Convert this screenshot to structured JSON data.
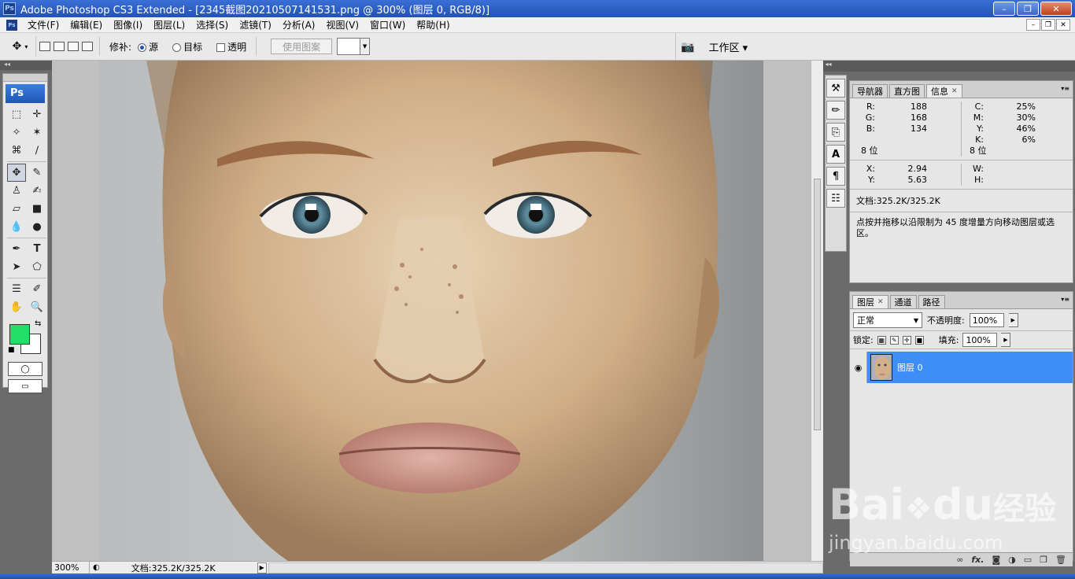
{
  "window": {
    "app_icon": "Ps",
    "title": "Adobe Photoshop CS3 Extended - [2345截图20210507141531.png @ 300% (图层 0, RGB/8)]",
    "controls": [
      "minimize",
      "maximize",
      "close"
    ]
  },
  "menubar": {
    "items": [
      "文件(F)",
      "编辑(E)",
      "图像(I)",
      "图层(L)",
      "选择(S)",
      "滤镜(T)",
      "分析(A)",
      "视图(V)",
      "窗口(W)",
      "帮助(H)"
    ]
  },
  "options": {
    "repair_label": "修补:",
    "source_label": "源",
    "target_label": "目标",
    "transparent_label": "透明",
    "use_pattern_label": "使用图案",
    "workspace_label": "工作区"
  },
  "toolbox": {
    "logo": "Ps",
    "foreground_color": "#22dd66",
    "background_color": "#ffffff",
    "tools": [
      "marquee-icon",
      "move-icon",
      "lasso-icon",
      "magic-wand-icon",
      "crop-icon",
      "slice-icon",
      "patch-icon",
      "brush-icon",
      "stamp-icon",
      "history-brush-icon",
      "eraser-icon",
      "gradient-icon",
      "blur-icon",
      "dodge-icon",
      "pen-icon",
      "type-icon",
      "path-select-icon",
      "shape-icon",
      "notes-icon",
      "eyedropper-icon",
      "hand-icon",
      "zoom-icon"
    ]
  },
  "status": {
    "zoom": "300%",
    "doc": "文档:325.2K/325.2K"
  },
  "info_panel": {
    "tabs": [
      "导航器",
      "直方图",
      "信息"
    ],
    "active_tab": "信息",
    "rgb": [
      {
        "k": "R:",
        "v": "188"
      },
      {
        "k": "G:",
        "v": "168"
      },
      {
        "k": "B:",
        "v": "134"
      }
    ],
    "cmyk": [
      {
        "k": "C:",
        "v": "25%"
      },
      {
        "k": "M:",
        "v": "30%"
      },
      {
        "k": "Y:",
        "v": "46%"
      },
      {
        "k": "K:",
        "v": "6%"
      }
    ],
    "bits_left": "8 位",
    "bits_right": "8 位",
    "xy": [
      {
        "k": "X:",
        "v": "2.94"
      },
      {
        "k": "Y:",
        "v": "5.63"
      }
    ],
    "wh": [
      {
        "k": "W:",
        "v": ""
      },
      {
        "k": "H:",
        "v": ""
      }
    ],
    "doc": "文档:325.2K/325.2K",
    "tip": "点按并拖移以沿限制为 45 度增量方向移动图层或选区。"
  },
  "layers_panel": {
    "tabs": [
      "图层",
      "通道",
      "路径"
    ],
    "active_tab": "图层",
    "blend_mode": "正常",
    "opacity_label": "不透明度:",
    "opacity": "100%",
    "lock_label": "锁定:",
    "fill_label": "填充:",
    "fill": "100%",
    "layers": [
      {
        "name": "图层 0"
      }
    ]
  },
  "watermark": {
    "brand": "Bai",
    "brand2": "du",
    "suffix": "经验",
    "url": "jingyan.baidu.com"
  }
}
